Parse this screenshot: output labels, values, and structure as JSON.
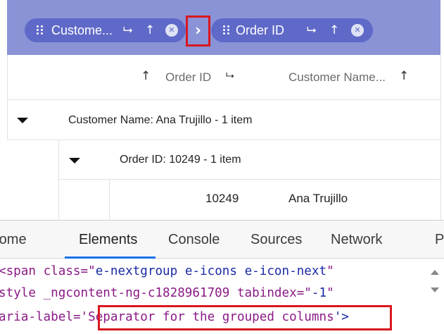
{
  "grid": {
    "group_chips": [
      {
        "label": "Custome...",
        "sort_icon": "↑",
        "group_icon": "⮡",
        "close_icon": "✕"
      },
      {
        "label": "Order ID",
        "sort_icon": "↑",
        "group_icon": "⮡",
        "close_icon": "✕"
      }
    ],
    "separator_glyph": "›",
    "header": {
      "col1_sort": "↑",
      "col1_label": "Order ID",
      "col1_group_icon": "⮡",
      "col2_label": "Customer Name...",
      "col2_sort": "↑"
    },
    "caption1": "Customer Name: Ana Trujillo - 1 item",
    "caption2": "Order ID: 10249 - 1 item",
    "row": {
      "order_id": "10249",
      "customer": "Ana Trujillo"
    }
  },
  "devtools": {
    "tabs": [
      "rome",
      "Elements",
      "Console",
      "Sources",
      "Network",
      "P"
    ],
    "active_tab": "Elements",
    "code": {
      "line1_tag_open": "<span ",
      "line1_attr": "class",
      "line1_eq": "=\"",
      "line1_val": "e-nextgroup e-icons e-icon-next",
      "line1_close": "\"",
      "line2_attr1": "style _ngcontent-ng-c1828961709 ",
      "line2_attr2": "tabindex",
      "line2_eq": "=\"",
      "line2_val": "-1",
      "line2_close": "\"",
      "line3_attr": "aria-label",
      "line3_eq": "='",
      "line3_val": "Separator for the grouped columns",
      "line3_close": "'>"
    }
  }
}
